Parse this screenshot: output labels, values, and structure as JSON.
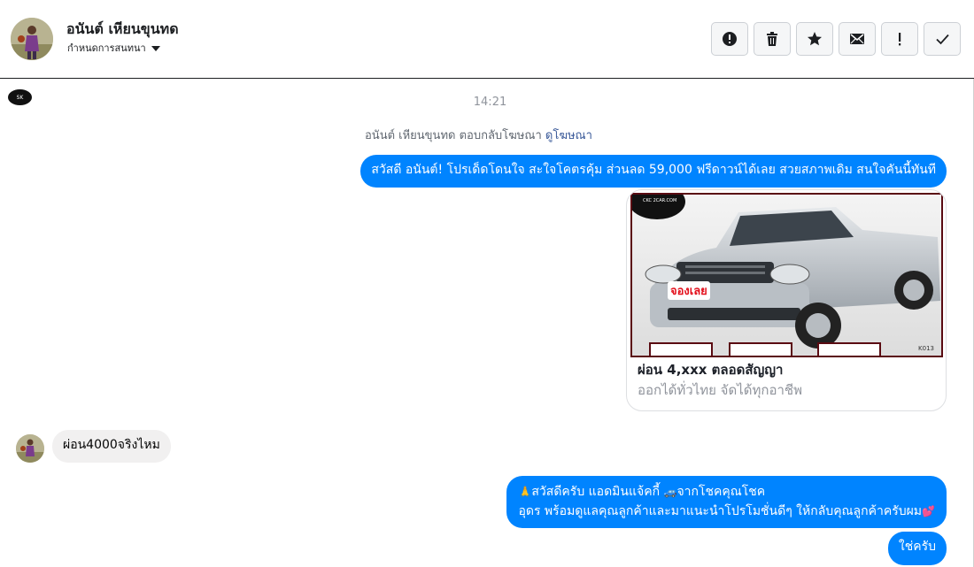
{
  "header": {
    "contact_name": "อนันต์ เหียนขุนทด",
    "subtitle": "กำหนดการสนทนา",
    "toolbar": [
      {
        "name": "report-button",
        "icon": "alert-circle-icon"
      },
      {
        "name": "delete-button",
        "icon": "trash-icon"
      },
      {
        "name": "star-button",
        "icon": "star-icon"
      },
      {
        "name": "mark-unread-button",
        "icon": "envelope-icon"
      },
      {
        "name": "important-button",
        "icon": "exclamation-icon"
      },
      {
        "name": "mark-done-button",
        "icon": "check-icon"
      }
    ]
  },
  "chat": {
    "timestamp": "14:21",
    "ad_reply_text": "อนันต์ เหียนขุนทด ตอบกลับโฆษณา",
    "ad_reply_link": "ดูโฆษณา",
    "messages": {
      "m1": "สวัสดี อนันต์! โปรเด็ดโดนใจ สะใจโคตรคุ้ม ส่วนลด 59,000 ฟรีดาวน์ได้เลย สวยสภาพเดิม สนใจคันนี้ทันที",
      "m2": "ผ่อน4000จริงไหม",
      "m3_line1": "สวัสดีครับ แอดมินแจ้คกี้",
      "m3_line1b": "จากโชคคุณโชค",
      "m3_line2": "อุดร พร้อมดูแลคุณลูกค้าและมาแนะนำโปรโมชั่นดีๆ ให้กลับคุณลูกค้าครับผม",
      "m4": "ใช่ครับ"
    },
    "card": {
      "title": "ผ่อน 4,xxx ตลอดสัญญา",
      "subtitle": "ออกได้ทั่วไทย จัดได้ทุกอาชีพ",
      "stamp": "จองเลย",
      "watermark": "CKC 2CAR.COM",
      "code": "K013"
    }
  },
  "colors": {
    "outgoing_bubble": "#0084ff",
    "incoming_bubble": "#f1f0f0",
    "link": "#385898"
  }
}
